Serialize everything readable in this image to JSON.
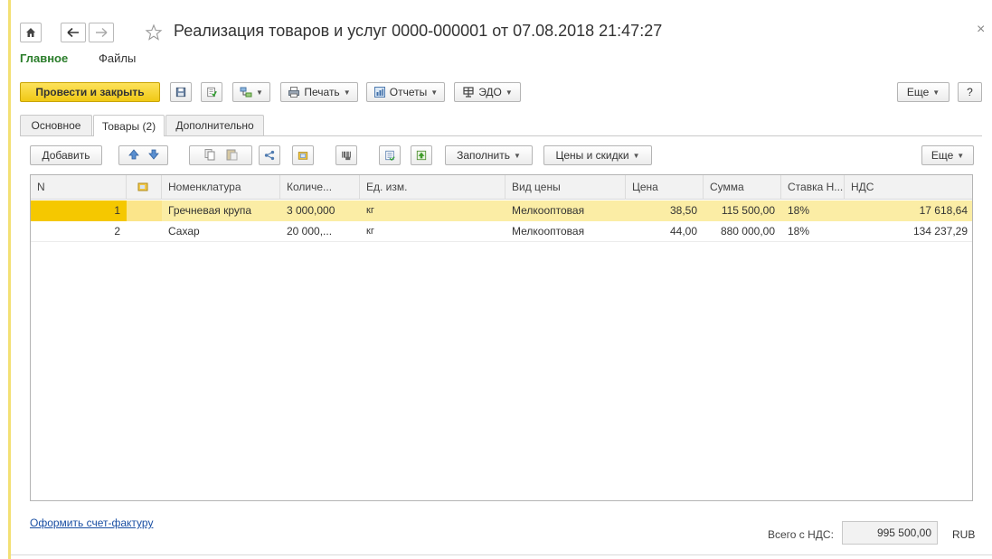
{
  "window": {
    "title": "Реализация товаров и услуг 0000-000001 от 07.08.2018 21:47:27",
    "close_glyph": "×"
  },
  "sections": {
    "main": "Главное",
    "files": "Файлы"
  },
  "toolbar": {
    "post_close": "Провести и закрыть",
    "print": "Печать",
    "reports": "Отчеты",
    "edo": "ЭДО",
    "more": "Еще",
    "help": "?"
  },
  "tabs": [
    {
      "label": "Основное",
      "active": false
    },
    {
      "label": "Товары (2)",
      "active": true
    },
    {
      "label": "Дополнительно",
      "active": false
    }
  ],
  "table_toolbar": {
    "add": "Добавить",
    "fill": "Заполнить",
    "prices": "Цены и скидки",
    "more": "Еще"
  },
  "columns": [
    "N",
    "",
    "Номенклатура",
    "Количе...",
    "Ед. изм.",
    "Вид цены",
    "Цена",
    "Сумма",
    "Ставка Н...",
    "НДС"
  ],
  "rows": [
    {
      "n": "1",
      "item": "Гречневая крупа",
      "qty": "3 000,000",
      "unit": "кг",
      "price_type": "Мелкооптовая",
      "price": "38,50",
      "sum": "115 500,00",
      "vat_rate": "18%",
      "vat": "17 618,64",
      "selected": true
    },
    {
      "n": "2",
      "item": "Сахар",
      "qty": "20 000,...",
      "unit": "кг",
      "price_type": "Мелкооптовая",
      "price": "44,00",
      "sum": "880 000,00",
      "vat_rate": "18%",
      "vat": "134 237,29",
      "selected": false
    }
  ],
  "footer": {
    "invoice_link": "Оформить счет-фактуру",
    "total_label": "Всего с НДС:",
    "total_value": "995 500,00",
    "currency": "RUB"
  },
  "colors": {
    "accent_yellow": "#f5c800",
    "primary_button": "#fde25b",
    "selected_row": "#fbeda5",
    "section_active": "#2a7d2a",
    "link": "#1a4fa3"
  },
  "icons": [
    "home-icon",
    "back-arrow-icon",
    "forward-arrow-icon",
    "star-icon",
    "save-icon",
    "post-icon",
    "structure-icon",
    "printer-icon",
    "report-icon",
    "edo-icon",
    "move-up-icon",
    "move-down-icon",
    "copy-icon",
    "paste-icon",
    "share-icon",
    "folder-icon",
    "barcode-icon",
    "list-icon",
    "import-icon"
  ]
}
